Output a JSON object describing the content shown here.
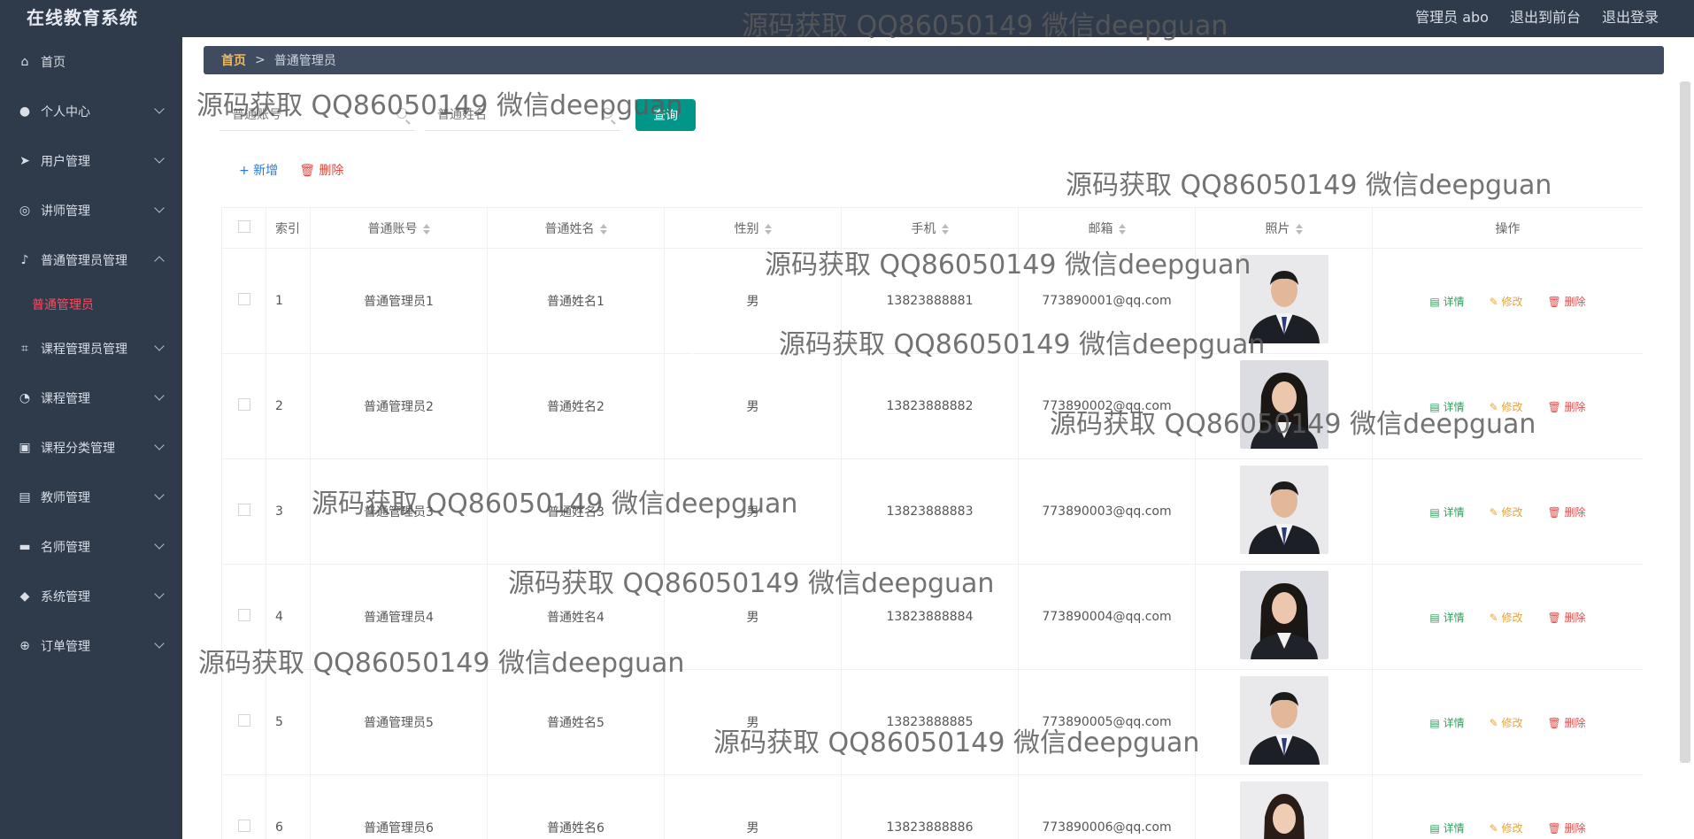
{
  "app": {
    "title": "在线教育系统"
  },
  "top_links": [
    "管理员 abo",
    "退出到前台",
    "退出登录"
  ],
  "sidebar": {
    "items": [
      {
        "label": "首页",
        "icon": "home-icon"
      },
      {
        "label": "个人中心",
        "icon": "person-icon"
      },
      {
        "label": "用户管理",
        "icon": "send-icon"
      },
      {
        "label": "讲师管理",
        "icon": "compass-icon"
      },
      {
        "label": "普通管理员管理",
        "icon": "mic-icon"
      },
      {
        "label": "课程管理员管理",
        "icon": "crop-icon"
      },
      {
        "label": "课程管理",
        "icon": "clock-icon"
      },
      {
        "label": "课程分类管理",
        "icon": "clipboard-icon"
      },
      {
        "label": "教师管理",
        "icon": "card-icon"
      },
      {
        "label": "名师管理",
        "icon": "chat-icon"
      },
      {
        "label": "系统管理",
        "icon": "pin-icon"
      },
      {
        "label": "订单管理",
        "icon": "globe-icon"
      }
    ],
    "active_sub": "普通管理员"
  },
  "breadcrumb": {
    "home": "首页",
    "sep": ">",
    "current": "普通管理员"
  },
  "search": {
    "account_placeholder": "普通账号",
    "name_placeholder": "普通姓名",
    "query_label": "查询"
  },
  "actions": {
    "add_label": "+ 新增",
    "delete_label": "删除"
  },
  "table": {
    "headers": [
      "索引",
      "普通账号",
      "普通姓名",
      "性别",
      "手机",
      "邮箱",
      "照片",
      "操作"
    ],
    "op_labels": {
      "detail": "详情",
      "edit": "修改",
      "delete": "删除"
    },
    "rows": [
      {
        "idx": "1",
        "account": "普通管理员1",
        "name": "普通姓名1",
        "sex": "男",
        "phone": "13823888881",
        "email": "773890001@qq.com",
        "photo": "male"
      },
      {
        "idx": "2",
        "account": "普通管理员2",
        "name": "普通姓名2",
        "sex": "男",
        "phone": "13823888882",
        "email": "773890002@qq.com",
        "photo": "female"
      },
      {
        "idx": "3",
        "account": "普通管理员3",
        "name": "普通姓名3",
        "sex": "男",
        "phone": "13823888883",
        "email": "773890003@qq.com",
        "photo": "male"
      },
      {
        "idx": "4",
        "account": "普通管理员4",
        "name": "普通姓名4",
        "sex": "男",
        "phone": "13823888884",
        "email": "773890004@qq.com",
        "photo": "female"
      },
      {
        "idx": "5",
        "account": "普通管理员5",
        "name": "普通姓名5",
        "sex": "男",
        "phone": "13823888885",
        "email": "773890005@qq.com",
        "photo": "male"
      },
      {
        "idx": "6",
        "account": "普通管理员6",
        "name": "普通姓名6",
        "sex": "男",
        "phone": "13823888886",
        "email": "773890006@qq.com",
        "photo": "female-red"
      }
    ]
  },
  "watermark": "源码获取 QQ86050149 微信deepguan",
  "colors": {
    "sidebar_bg": "#2f3a4b",
    "breadcrumb_bg": "#3f4c60",
    "query_btn": "#009688",
    "active_sub": "#ff4a5e",
    "detail": "#2e9e5b",
    "edit": "#e8a33c",
    "delete": "#e24b4b"
  }
}
